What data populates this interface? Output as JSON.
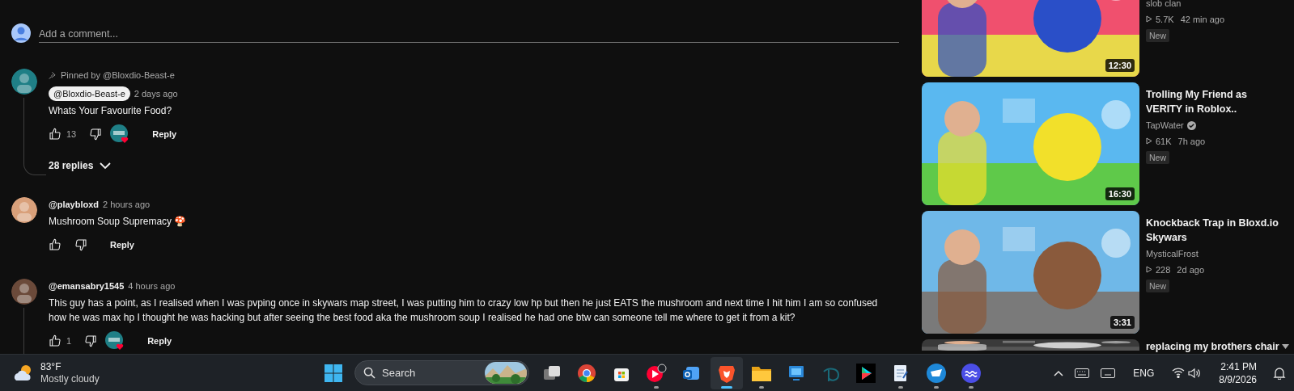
{
  "comment_box": {
    "placeholder": "Add a comment..."
  },
  "comments": [
    {
      "pinned_by": "Pinned by @Bloxdio-Beast-e",
      "author": "@Bloxdio-Beast-e",
      "author_is_creator": true,
      "time": "2 days ago",
      "text": "Whats Your Favourite Food?",
      "likes": "13",
      "creator_heart": true,
      "reply": "Reply",
      "replies": "28 replies"
    },
    {
      "author": "@playbloxd",
      "author_is_creator": false,
      "time": "2 hours ago",
      "text": "Mushroom Soup Supremacy 🍄",
      "creator_heart": false,
      "reply": "Reply"
    },
    {
      "author": "@emansabry1545",
      "author_is_creator": false,
      "time": "4 hours ago",
      "text": "This guy has a point, as I realised when I was pvping once in skywars map street, I was putting him to crazy low hp but then he just EATS the mushroom and next time I hit him I am so confused how he was max hp I thought he was hacking but after seeing the best food aka the mushroom soup I realised he had one btw can someone tell me where to get it from a kit?",
      "likes": "1",
      "creator_heart": true,
      "reply": "Reply",
      "thread": true
    }
  ],
  "videos": [
    {
      "channel": "slob clan",
      "verified": false,
      "views": "5.7K",
      "age": "42 min ago",
      "badge": "New",
      "duration": "12:30"
    },
    {
      "title": "Trolling My Friend as VERITY in Roblox..",
      "channel": "TapWater",
      "verified": true,
      "views": "61K",
      "age": "7h ago",
      "badge": "New",
      "duration": "16:30"
    },
    {
      "title": "Knockback Trap in Bloxd.io Skywars",
      "channel": "MysticalFrost",
      "verified": false,
      "views": "228",
      "age": "2d ago",
      "badge": "New",
      "duration": "3:31"
    },
    {
      "title": "replacing my brothers chair"
    }
  ],
  "taskbar": {
    "weather": {
      "temp": "83°F",
      "condition": "Mostly cloudy"
    },
    "search": {
      "placeholder": "Search"
    },
    "apps": [
      {
        "kind": "taskview",
        "running": false,
        "selected": false
      },
      {
        "kind": "chrome",
        "running": false,
        "selected": false
      },
      {
        "kind": "store",
        "running": false,
        "selected": false
      },
      {
        "kind": "music",
        "running": true,
        "selected": false
      },
      {
        "kind": "mail",
        "running": false,
        "selected": false
      },
      {
        "kind": "brave",
        "running": true,
        "selected": true
      },
      {
        "kind": "folder",
        "running": true,
        "selected": false
      },
      {
        "kind": "monitor",
        "running": false,
        "selected": false
      },
      {
        "kind": "disney",
        "running": false,
        "selected": false
      },
      {
        "kind": "play",
        "running": false,
        "selected": false
      },
      {
        "kind": "notepad",
        "running": true,
        "selected": false
      },
      {
        "kind": "cloud",
        "running": true,
        "selected": false
      },
      {
        "kind": "wave",
        "running": true,
        "selected": false
      }
    ],
    "tray": {
      "language": "ENG",
      "time": "2:41 PM",
      "date": "8/9/2026"
    }
  }
}
